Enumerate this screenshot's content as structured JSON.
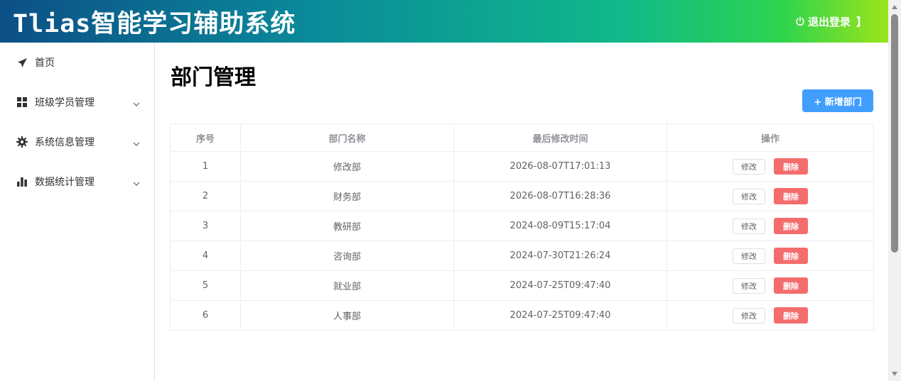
{
  "header": {
    "app_title": "Tlias智能学习辅助系统",
    "logout_label": "退出登录",
    "logout_bracket": "】"
  },
  "sidebar": {
    "items": [
      {
        "label": "首页",
        "icon": "paper-plane-icon"
      },
      {
        "label": "班级学员管理",
        "icon": "grid-icon"
      },
      {
        "label": "系统信息管理",
        "icon": "gear-icon"
      },
      {
        "label": "数据统计管理",
        "icon": "bar-chart-icon"
      }
    ]
  },
  "main": {
    "page_title": "部门管理",
    "add_button": "+ 新增部门",
    "table": {
      "headers": [
        "序号",
        "部门名称",
        "最后修改时间",
        "操作"
      ],
      "rows": [
        {
          "index": "1",
          "name": "修改部",
          "updated": "2026-08-07T17:01:13"
        },
        {
          "index": "2",
          "name": "财务部",
          "updated": "2026-08-07T16:28:36"
        },
        {
          "index": "3",
          "name": "教研部",
          "updated": "2024-08-09T15:17:04"
        },
        {
          "index": "4",
          "name": "咨询部",
          "updated": "2024-07-30T21:26:24"
        },
        {
          "index": "5",
          "name": "就业部",
          "updated": "2024-07-25T09:47:40"
        },
        {
          "index": "6",
          "name": "人事部",
          "updated": "2024-07-25T09:47:40"
        }
      ],
      "edit_label": "修改",
      "delete_label": "删除"
    }
  },
  "colors": {
    "primary": "#409eff",
    "danger": "#f56c6c"
  }
}
